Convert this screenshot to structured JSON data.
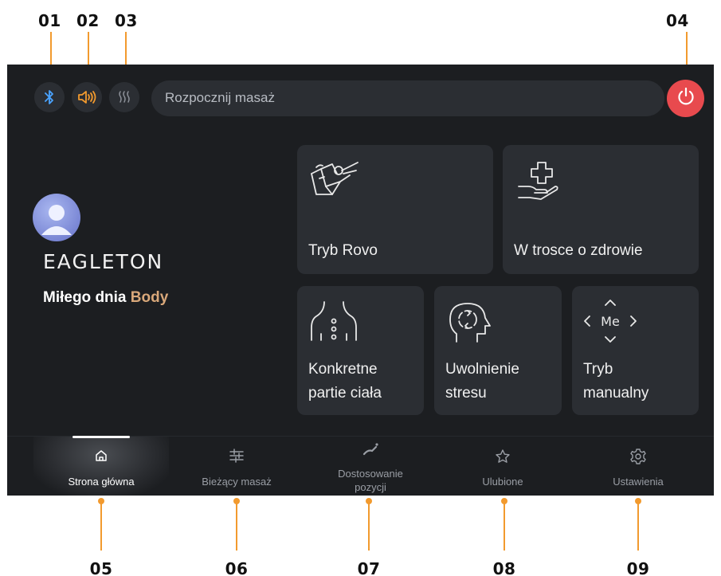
{
  "callouts": {
    "top": [
      "01",
      "02",
      "03",
      "04"
    ],
    "bottom": [
      "05",
      "06",
      "07",
      "08",
      "09"
    ]
  },
  "topbar": {
    "search_placeholder": "Rozpocznij masaż",
    "icons": [
      "bluetooth-icon",
      "speaker-icon",
      "heat-icon",
      "power-icon"
    ]
  },
  "profile": {
    "brand": "EAGLETON",
    "greeting": "Miłego dnia",
    "user_name": "Body"
  },
  "tiles": [
    {
      "label": "Tryb Rovo",
      "icon": "massage-chair-icon"
    },
    {
      "label": "W trosce o zdrowie",
      "icon": "health-care-icon"
    },
    {
      "label": "Konkretne partie ciała",
      "icon": "body-parts-icon"
    },
    {
      "label": "Uwolnienie stresu",
      "icon": "stress-relief-icon"
    },
    {
      "label": "Tryb manualny",
      "icon": "manual-mode-icon",
      "icon_text": "Me"
    }
  ],
  "nav": [
    {
      "label": "Strona główna",
      "icon": "home-icon",
      "active": true
    },
    {
      "label": "Bieżący masaż",
      "icon": "sliders-icon",
      "active": false
    },
    {
      "label": "Dostosowanie pozycji",
      "icon": "recline-icon",
      "active": false
    },
    {
      "label": "Ulubione",
      "icon": "star-icon",
      "active": false
    },
    {
      "label": "Ustawienia",
      "icon": "gear-icon",
      "active": false
    }
  ],
  "colors": {
    "screen_bg": "#1c1e21",
    "tile_bg": "#2b2e33",
    "accent": "#f29a2e",
    "power": "#e84a4e",
    "name": "#d9a87a",
    "bluetooth": "#4aa3ff"
  }
}
